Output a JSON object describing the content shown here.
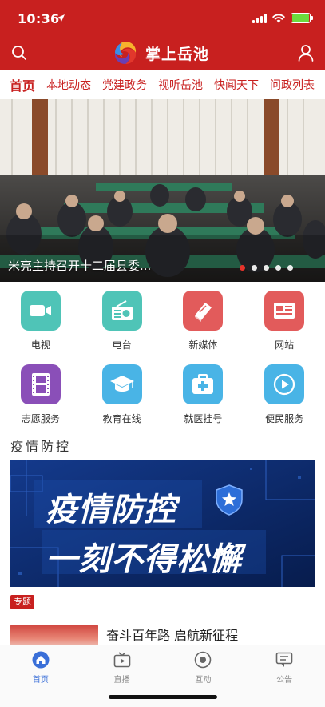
{
  "status_bar": {
    "time": "10:36"
  },
  "app": {
    "title": "掌上岳池"
  },
  "channels": [
    {
      "label": "首页",
      "active": true
    },
    {
      "label": "本地动态",
      "active": false
    },
    {
      "label": "党建政务",
      "active": false
    },
    {
      "label": "视听岳池",
      "active": false
    },
    {
      "label": "快闻天下",
      "active": false
    },
    {
      "label": "问政列表",
      "active": false
    }
  ],
  "banner": {
    "caption": "米亮主持召开十二届县委...",
    "slide_count": 5,
    "active_slide": 1
  },
  "services": [
    {
      "label": "电视",
      "icon": "tv-camera-icon",
      "color": "#4fc4b7"
    },
    {
      "label": "电台",
      "icon": "radio-icon",
      "color": "#4fc4b7"
    },
    {
      "label": "新媒体",
      "icon": "book-icon",
      "color": "#e25b5b"
    },
    {
      "label": "网站",
      "icon": "website-icon",
      "color": "#e25b5b"
    },
    {
      "label": "志愿服务",
      "icon": "film-icon",
      "color": "#8a4fb8"
    },
    {
      "label": "教育在线",
      "icon": "graduation-cap-icon",
      "color": "#49b4e6"
    },
    {
      "label": "就医挂号",
      "icon": "medical-kit-icon",
      "color": "#49b4e6"
    },
    {
      "label": "便民服务",
      "icon": "play-icon",
      "color": "#49b4e6"
    }
  ],
  "section": {
    "title": "疫情防控",
    "promo_line1": "疫情防控",
    "promo_line2": "一刻不得松懈"
  },
  "tag": "专题",
  "news": {
    "title": "奋斗百年路 启航新征程"
  },
  "tabs": [
    {
      "label": "首页",
      "icon": "home-icon",
      "active": true
    },
    {
      "label": "直播",
      "icon": "live-tv-icon",
      "active": false
    },
    {
      "label": "互动",
      "icon": "interact-icon",
      "active": false
    },
    {
      "label": "公告",
      "icon": "notice-icon",
      "active": false
    }
  ],
  "colors": {
    "brand_red": "#c8201f",
    "tab_active": "#3a6fd8"
  }
}
